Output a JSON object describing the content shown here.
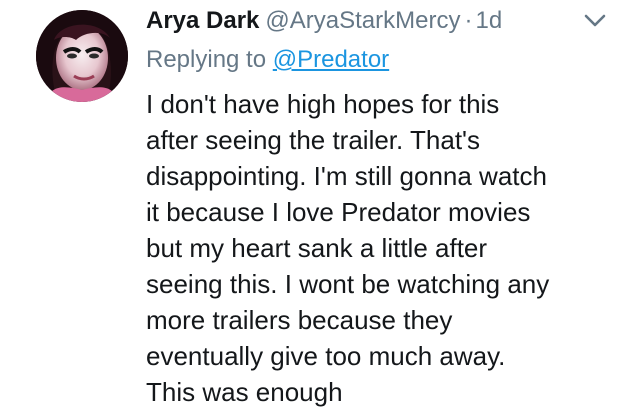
{
  "tweet": {
    "author": {
      "name": "Arya Dark",
      "handle": "@AryaStarkMercy"
    },
    "separator": "·",
    "time": "1d",
    "replying": {
      "prefix": "Replying to",
      "mention": "@Predator"
    },
    "text_lines": [
      "I don't have high hopes for this",
      "after seeing the trailer. That's",
      "disappointing. I'm still gonna watch",
      "it because I love Predator movies",
      "but my heart sank a little after",
      "seeing this. I wont be watching any",
      "more trailers because they",
      "eventually give too much away.",
      "This was enough"
    ]
  },
  "icons": {
    "menu": "chevron-down-icon",
    "avatar": "profile-photo"
  },
  "colors": {
    "text": "#14171a",
    "secondary": "#657786",
    "link": "#1b95e0"
  }
}
